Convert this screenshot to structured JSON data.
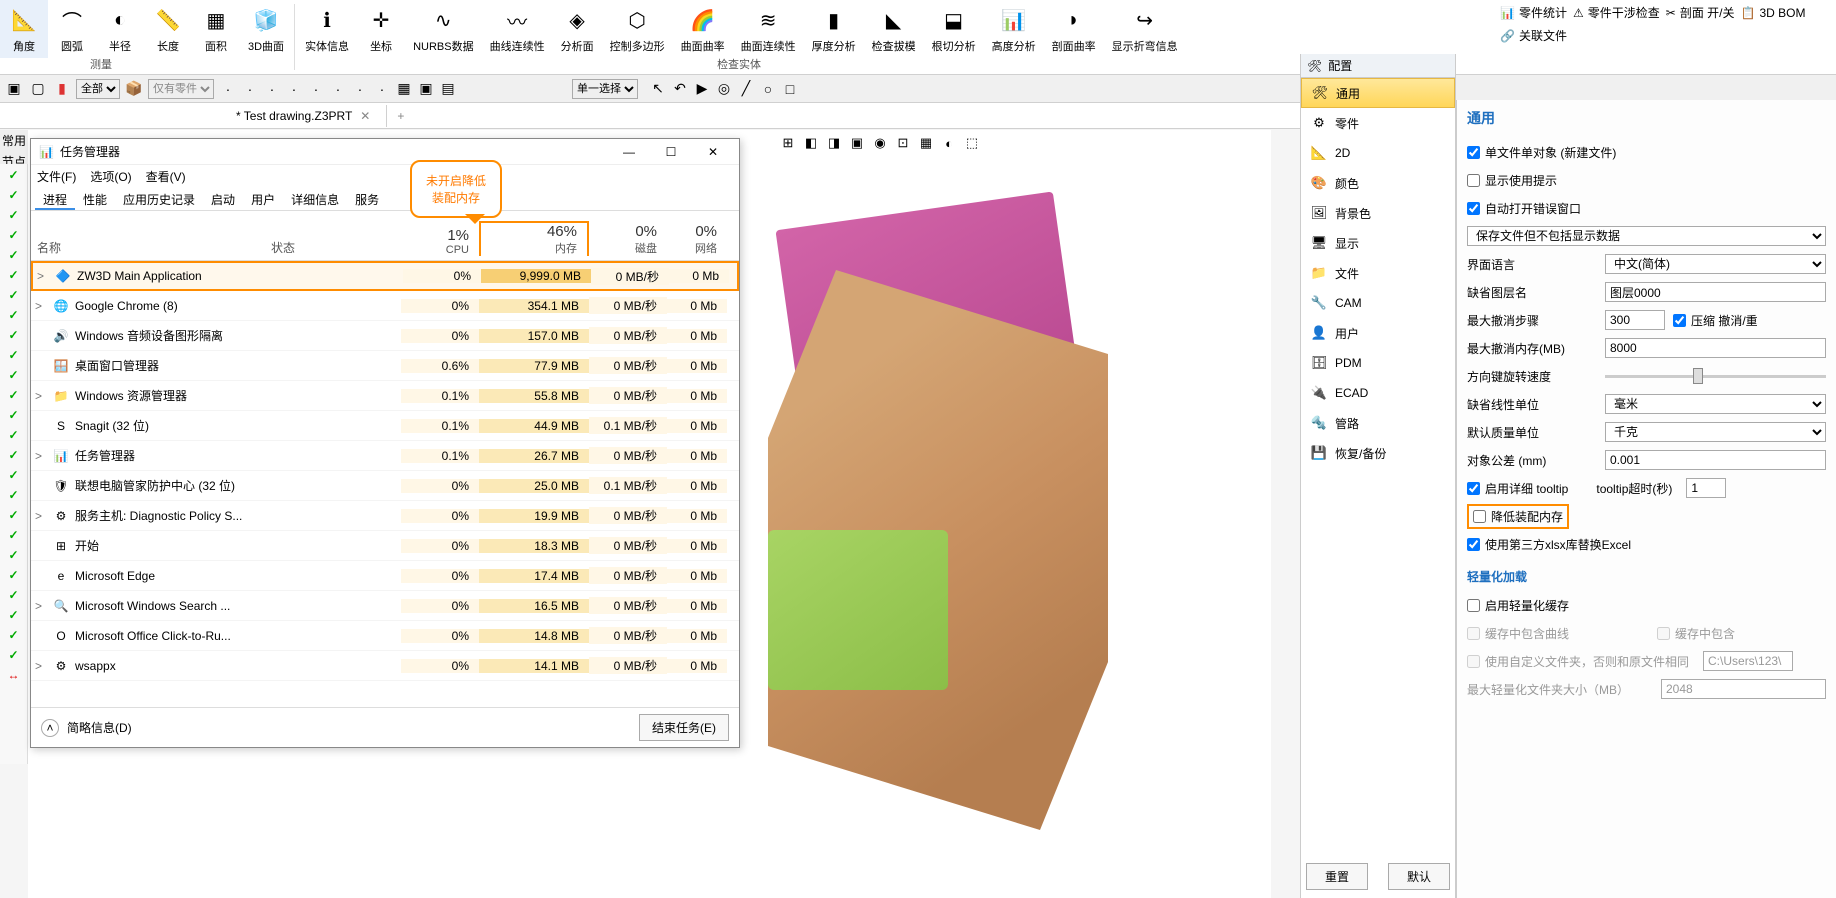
{
  "ribbon": {
    "items": [
      "角度",
      "圆弧",
      "半径",
      "长度",
      "面积",
      "3D曲面",
      "实体信息",
      "坐标",
      "NURBS数据",
      "曲线连续性",
      "分析面",
      "控制多边形",
      "曲面曲率",
      "曲面连续性",
      "厚度分析",
      "检查拔模",
      "根切分析",
      "高度分析",
      "剖面曲率",
      "显示折弯信息"
    ],
    "group1": "测量",
    "group2": "检查实体",
    "right": [
      "零件统计",
      "零件干涉检查",
      "剖面 开/关",
      "3D BOM",
      "关联文件"
    ]
  },
  "toolbar2": {
    "sel1": "全部",
    "sel2": "仅有零件",
    "sel3": "单一选择"
  },
  "tab": {
    "name": "* Test drawing.Z3PRT"
  },
  "leftHeader": [
    "常用",
    "节点"
  ],
  "taskman": {
    "title": "任务管理器",
    "menu": [
      "文件(F)",
      "选项(O)",
      "查看(V)"
    ],
    "tabs": [
      "进程",
      "性能",
      "应用历史记录",
      "启动",
      "用户",
      "详细信息",
      "服务"
    ],
    "cols": {
      "name": "名称",
      "status": "状态",
      "cpu": "CPU",
      "mem": "内存",
      "disk": "磁盘",
      "net": "网络"
    },
    "pct": {
      "cpu": "1%",
      "mem": "46%",
      "disk": "0%",
      "net": "0%"
    },
    "rows": [
      {
        "exp": ">",
        "icon": "🔷",
        "name": "ZW3D Main Application",
        "cpu": "0%",
        "mem": "9,999.0 MB",
        "disk": "0 MB/秒",
        "net": "0 Mb",
        "hl": true
      },
      {
        "exp": ">",
        "icon": "🌐",
        "name": "Google Chrome (8)",
        "cpu": "0%",
        "mem": "354.1 MB",
        "disk": "0 MB/秒",
        "net": "0 Mb"
      },
      {
        "exp": "",
        "icon": "🔊",
        "name": "Windows 音频设备图形隔离",
        "cpu": "0%",
        "mem": "157.0 MB",
        "disk": "0 MB/秒",
        "net": "0 Mb"
      },
      {
        "exp": "",
        "icon": "🪟",
        "name": "桌面窗口管理器",
        "cpu": "0.6%",
        "mem": "77.9 MB",
        "disk": "0 MB/秒",
        "net": "0 Mb"
      },
      {
        "exp": ">",
        "icon": "📁",
        "name": "Windows 资源管理器",
        "cpu": "0.1%",
        "mem": "55.8 MB",
        "disk": "0 MB/秒",
        "net": "0 Mb"
      },
      {
        "exp": "",
        "icon": "S",
        "name": "Snagit (32 位)",
        "cpu": "0.1%",
        "mem": "44.9 MB",
        "disk": "0.1 MB/秒",
        "net": "0 Mb"
      },
      {
        "exp": ">",
        "icon": "📊",
        "name": "任务管理器",
        "cpu": "0.1%",
        "mem": "26.7 MB",
        "disk": "0 MB/秒",
        "net": "0 Mb"
      },
      {
        "exp": "",
        "icon": "🛡",
        "name": "联想电脑管家防护中心 (32 位)",
        "cpu": "0%",
        "mem": "25.0 MB",
        "disk": "0.1 MB/秒",
        "net": "0 Mb"
      },
      {
        "exp": ">",
        "icon": "⚙",
        "name": "服务主机: Diagnostic Policy S...",
        "cpu": "0%",
        "mem": "19.9 MB",
        "disk": "0 MB/秒",
        "net": "0 Mb"
      },
      {
        "exp": "",
        "icon": "⊞",
        "name": "开始",
        "cpu": "0%",
        "mem": "18.3 MB",
        "disk": "0 MB/秒",
        "net": "0 Mb"
      },
      {
        "exp": "",
        "icon": "e",
        "name": "Microsoft Edge",
        "cpu": "0%",
        "mem": "17.4 MB",
        "disk": "0 MB/秒",
        "net": "0 Mb"
      },
      {
        "exp": ">",
        "icon": "🔍",
        "name": "Microsoft Windows Search ...",
        "cpu": "0%",
        "mem": "16.5 MB",
        "disk": "0 MB/秒",
        "net": "0 Mb"
      },
      {
        "exp": "",
        "icon": "O",
        "name": "Microsoft Office Click-to-Ru...",
        "cpu": "0%",
        "mem": "14.8 MB",
        "disk": "0 MB/秒",
        "net": "0 Mb"
      },
      {
        "exp": ">",
        "icon": "⚙",
        "name": "wsappx",
        "cpu": "0%",
        "mem": "14.1 MB",
        "disk": "0 MB/秒",
        "net": "0 Mb"
      }
    ],
    "brief": "简略信息(D)",
    "end": "结束任务(E)"
  },
  "callout": {
    "l1": "未开启降低",
    "l2": "装配内存"
  },
  "cfg": {
    "title": "配置",
    "items": [
      "通用",
      "零件",
      "2D",
      "颜色",
      "背景色",
      "显示",
      "文件",
      "CAM",
      "用户",
      "PDM",
      "ECAD",
      "管路",
      "恢复/备份"
    ],
    "reset": "重置",
    "default": "默认"
  },
  "props": {
    "title": "通用",
    "cb1": "单文件单对象 (新建文件)",
    "cb2": "显示使用提示",
    "cb3": "自动打开错误窗口",
    "saveOpt": "保存文件但不包括显示数据",
    "lang_l": "界面语言",
    "lang_v": "中文(简体)",
    "layer_l": "缺省图层名",
    "layer_v": "图层0000",
    "undo_l": "最大撤消步骤",
    "undo_v": "300",
    "undo_cb": "压缩 撤消/重",
    "undomem_l": "最大撤消内存(MB)",
    "undomem_v": "8000",
    "rot_l": "方向键旋转速度",
    "lin_l": "缺省线性单位",
    "lin_v": "毫米",
    "mass_l": "默认质量单位",
    "mass_v": "千克",
    "tol_l": "对象公差   (mm)",
    "tol_v": "0.001",
    "tt_cb": "启用详细 tooltip",
    "tt_l": "tooltip超时(秒)",
    "tt_v": "1",
    "lowmem": "降低装配内存",
    "xlsx": "使用第三方xlsx库替换Excel",
    "light_title": "轻量化加载",
    "light_cb": "启用轻量化缓存",
    "light_curve": "缓存中包含曲线",
    "light_curve2": "缓存中包含",
    "light_folder": "使用自定义文件夹，否则和原文件相同",
    "light_folder_v": "C:\\Users\\123\\",
    "light_size": "最大轻量化文件夹大小（MB）",
    "light_size_v": "2048"
  }
}
